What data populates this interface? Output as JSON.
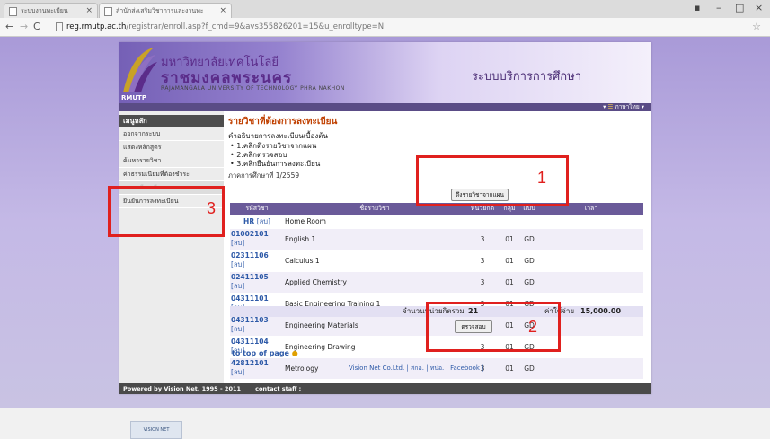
{
  "browser": {
    "tabs": [
      {
        "label": "ระบบงานทะเบียน"
      },
      {
        "label": "สำนักส่งเสริมวิชาการและงานทะ"
      }
    ],
    "url_host": "reg.rmutp.ac.th",
    "url_rest": "/registrar/enroll.asp?f_cmd=9&avs355826201=15&u_enrolltype=N"
  },
  "header": {
    "logo_th1": "มหาวิทยาลัยเทคโนโลยี",
    "logo_th2": "ราชมงคลพระนคร",
    "logo_en": "RAJAMANGALA UNIVERSITY OF TECHNOLOGY PHRA NAKHON",
    "logo_abbr": "RMUTP",
    "system_title": "ระบบบริการการศึกษา",
    "language": "ภาษาไทย"
  },
  "sidebar": {
    "heading": "เมนูหลัก",
    "items": [
      {
        "label": "ออกจากระบบ"
      },
      {
        "label": "แสดงหลักสูตร"
      },
      {
        "label": "ค้นหารายวิชา"
      },
      {
        "label": "ค่าธรรมเนียมที่ต้องชำระ"
      },
      {
        "label": "ลงทะเบียนเรียน"
      },
      {
        "label": "ยืนยันการลงทะเบียน"
      }
    ]
  },
  "content": {
    "title": "รายวิชาที่ต้องการลงทะเบียน",
    "desc": "คำอธิบายการลงทะเบียนเบื้องต้น",
    "steps": [
      "1.คลิกดึงรายวิชาจากแผน",
      "2.คลิกตรวจสอบ",
      "3.คลิกยืนยันการลงทะเบียน"
    ],
    "term": "ภาคการศึกษาที่ 1/2559",
    "pull_button": "ดึงรายวิชาจากแผน",
    "check_button": "ตรวจสอบ",
    "table": {
      "headers": [
        "รหัสวิชา",
        "ชื่อรายวิชา",
        "หน่วยกิต",
        "กลุ่ม",
        "แบบ",
        "เวลา"
      ],
      "rows": [
        {
          "code": "HR",
          "tag": "[ลบ]",
          "name": "Home Room",
          "credit": "",
          "group": "",
          "type": ""
        },
        {
          "code": "01002101",
          "tag": "[ลบ]",
          "name": "English 1",
          "credit": "3",
          "group": "01",
          "type": "GD"
        },
        {
          "code": "02311106",
          "tag": "[ลบ]",
          "name": "Calculus 1",
          "credit": "3",
          "group": "01",
          "type": "GD"
        },
        {
          "code": "02411105",
          "tag": "[ลบ]",
          "name": "Applied Chemistry",
          "credit": "3",
          "group": "01",
          "type": "GD"
        },
        {
          "code": "04311101",
          "tag": "[ลบ]",
          "name": "Basic Engineering Training 1",
          "credit": "3",
          "group": "01",
          "type": "GD"
        },
        {
          "code": "04311103",
          "tag": "[ลบ]",
          "name": "Engineering Materials",
          "credit": "3",
          "group": "01",
          "type": "GD"
        },
        {
          "code": "04311104",
          "tag": "[ลบ]",
          "name": "Engineering Drawing",
          "credit": "3",
          "group": "01",
          "type": "GD"
        },
        {
          "code": "42812101",
          "tag": "[ลบ]",
          "name": "Metrology",
          "credit": "3",
          "group": "01",
          "type": "GD"
        }
      ]
    },
    "summary_label": "จำนวนหน่วยกิตรวม",
    "summary_credits": "21",
    "fee_label": "ค่าใช้จ่าย",
    "fee_value": "15,000.00"
  },
  "footer": {
    "top_link": "to top of page",
    "links": "Vision Net Co.Ltd. | สกอ. | ทปอ. | Facebook |",
    "powered": "Powered by Vision Net, 1995 - 2011",
    "contact": "contact staff :",
    "vn_logo": "VISION NET"
  },
  "annotations": [
    "1",
    "2",
    "3"
  ],
  "colors": {
    "annotation": "#e0201e",
    "accent": "#6a5a99",
    "title": "#c04000",
    "link": "#2e5aa8"
  }
}
